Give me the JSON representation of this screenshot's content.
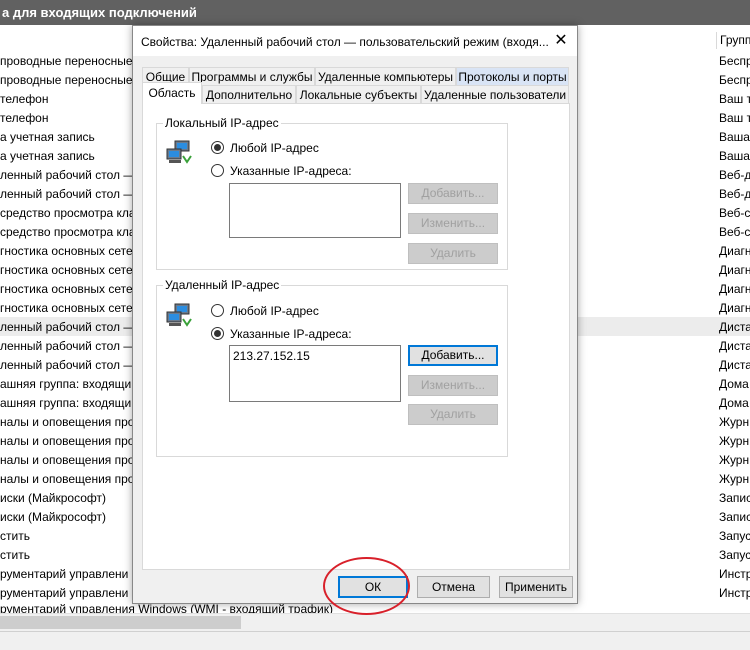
{
  "background": {
    "header_title": "а для входящих подключений",
    "right_column_header": "Групп",
    "left_rows": [
      "проводные переносные у",
      "проводные переносные у",
      "телефон",
      "телефон",
      "а учетная запись",
      "а учетная запись",
      "ленный рабочий стол —",
      "ленный рабочий стол —",
      "средство просмотра кла",
      "средство просмотра кла",
      "гностика основных сете",
      "гностика основных сете",
      "гностика основных сете",
      "гностика основных сете",
      "ленный рабочий стол —",
      "ленный рабочий стол —",
      "ленный рабочий стол —",
      "ашняя группа: входящи",
      "ашняя группа: входящи",
      "налы и оповещения про",
      "налы и оповещения про",
      "налы и оповещения про",
      "налы и оповещения про",
      "иски (Майкрософт)",
      "иски (Майкрософт)",
      "стить",
      "стить",
      "рументарий управлени",
      "рументарий управлени"
    ],
    "right_rows": [
      "Беспр",
      "Беспр",
      "Ваш т",
      "Ваш т",
      "Ваша",
      "Ваша",
      "Веб-д",
      "Веб-д",
      "Веб-с",
      "Веб-с",
      "Диагн",
      "Диагн",
      "Диагн",
      "Диагн",
      "Диста",
      "Диста",
      "Диста",
      "Дома",
      "Дома",
      "Журн",
      "Журн",
      "Журн",
      "Журн",
      "Запис",
      "Запис",
      "Запус",
      "Запус",
      "Инстр",
      "Инстр"
    ],
    "bottom_row": "рументарий управления Windows (WMI - входящий трафик)"
  },
  "dialog": {
    "title": "Свойства: Удаленный рабочий стол — пользовательский режим (входя...",
    "close_label": "✕",
    "tabs_row1": [
      "Общие",
      "Программы и службы",
      "Удаленные компьютеры",
      "Протоколы и порты"
    ],
    "tabs_row2": [
      "Область",
      "Дополнительно",
      "Локальные субъекты",
      "Удаленные пользователи"
    ],
    "local": {
      "group_label": "Локальный IP-адрес",
      "radio_any": "Любой IP-адрес",
      "radio_specified": "Указанные IP-адреса:",
      "selected": "any",
      "addresses": [],
      "add": "Добавить...",
      "edit": "Изменить...",
      "remove": "Удалить"
    },
    "remote": {
      "group_label": "Удаленный IP-адрес",
      "radio_any": "Любой IP-адрес",
      "radio_specified": "Указанные IP-адреса:",
      "selected": "specified",
      "addresses": [
        "213.27.152.15"
      ],
      "add": "Добавить...",
      "edit": "Изменить...",
      "remove": "Удалить"
    },
    "buttons": {
      "ok": "ОК",
      "cancel": "Отмена",
      "apply": "Применить"
    }
  },
  "colors": {
    "accent": "#0078d7",
    "highlight_circle": "#d8202a",
    "header_bg": "#616161"
  }
}
